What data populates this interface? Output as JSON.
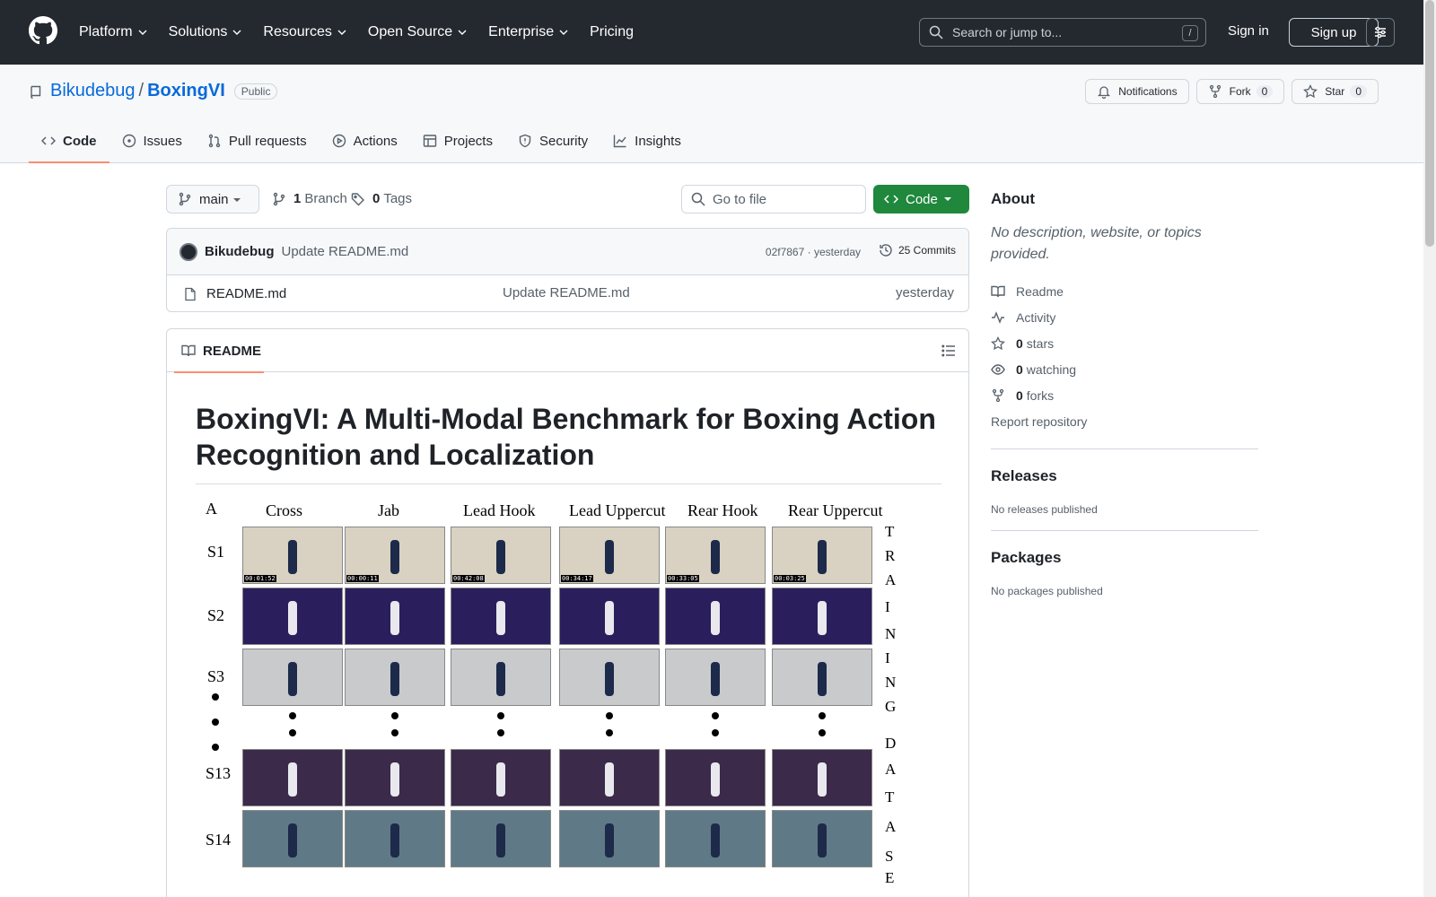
{
  "header": {
    "nav": [
      "Platform",
      "Solutions",
      "Resources",
      "Open Source",
      "Enterprise",
      "Pricing"
    ],
    "search_placeholder": "Search or jump to...",
    "search_shortcut": "/",
    "signin": "Sign in",
    "signup": "Sign up"
  },
  "repo": {
    "owner": "Bikudebug",
    "separator": "/",
    "name": "BoxingVI",
    "visibility": "Public",
    "notifications": "Notifications",
    "fork": "Fork",
    "fork_count": "0",
    "star": "Star",
    "star_count": "0",
    "tabs": [
      "Code",
      "Issues",
      "Pull requests",
      "Actions",
      "Projects",
      "Security",
      "Insights"
    ]
  },
  "toolbar": {
    "branch": "main",
    "branch_count": "1",
    "branch_label": "Branch",
    "tag_count": "0",
    "tag_label": "Tags",
    "goto_placeholder": "Go to file",
    "code_label": "Code"
  },
  "commit": {
    "author": "Bikudebug",
    "message": "Update README.md",
    "hash": "02f7867",
    "dot": "·",
    "time": "yesterday",
    "commits": "25 Commits"
  },
  "files": [
    {
      "name": "README.md",
      "message": "Update README.md",
      "time": "yesterday"
    }
  ],
  "readme": {
    "tab": "README",
    "title": "BoxingVI: A Multi-Modal Benchmark for Boxing Action Recognition and Localization"
  },
  "figure": {
    "corner": "A",
    "columns": [
      "Cross",
      "Jab",
      "Lead Hook",
      "Lead Uppercut",
      "Rear Hook",
      "Rear Uppercut"
    ],
    "rows": [
      "S1",
      "S2",
      "S3",
      "S13",
      "S14"
    ],
    "side_letters": [
      "T",
      "R",
      "A",
      "I",
      "N",
      "I",
      "N",
      "G",
      "D",
      "A",
      "T",
      "A",
      "S",
      "E"
    ],
    "timestamps": [
      "00:01:52",
      "00:00:11",
      "00:42:08",
      "00:34:17",
      "00:33:05",
      "00:03:25"
    ],
    "frame_colors": [
      "#d9d2c2",
      "#2a1f5c",
      "#c9cacb",
      "#3b2a4a",
      "#5f7a86"
    ]
  },
  "sidebar": {
    "about_title": "About",
    "about_desc": "No description, website, or topics provided.",
    "readme": "Readme",
    "activity": "Activity",
    "stars_count": "0",
    "stars": "stars",
    "watching_count": "0",
    "watching": "watching",
    "forks_count": "0",
    "forks": "forks",
    "report": "Report repository",
    "releases_title": "Releases",
    "releases_empty": "No releases published",
    "packages_title": "Packages",
    "packages_empty": "No packages published"
  }
}
